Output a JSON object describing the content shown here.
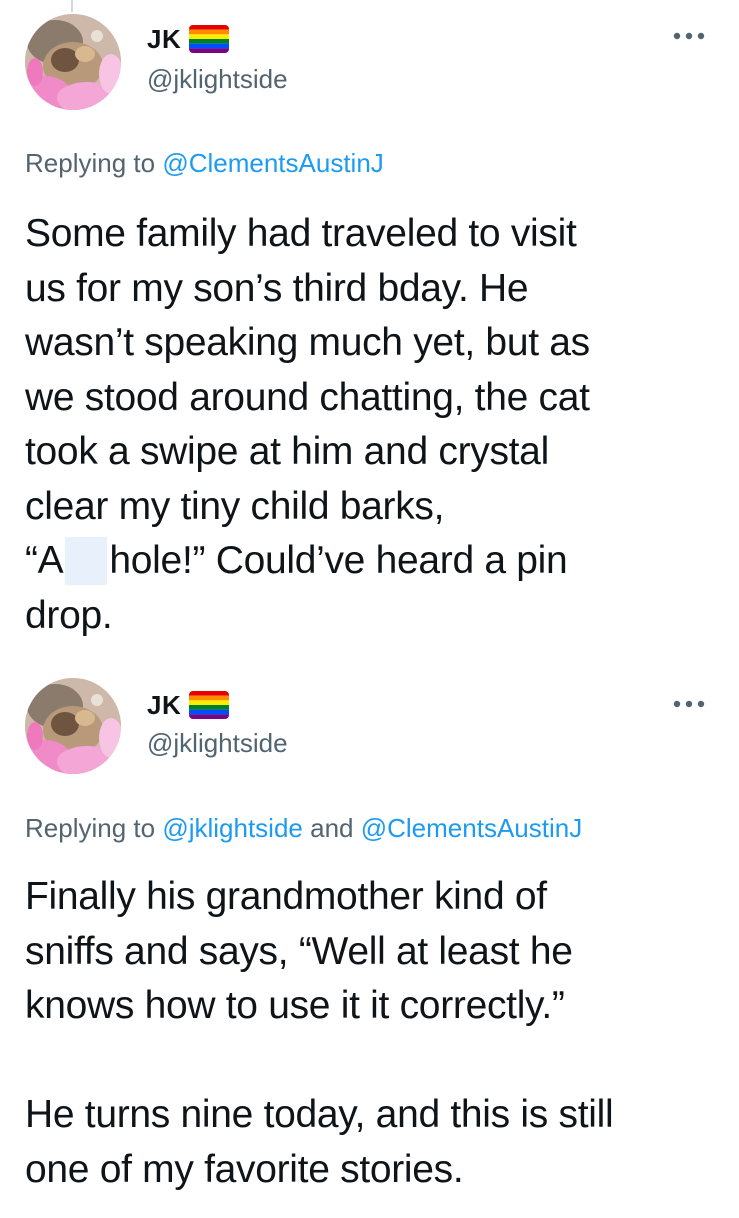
{
  "tweets": [
    {
      "display_name": "JK",
      "handle": "@jklightside",
      "reply_prefix": "Replying to",
      "reply_mentions": [
        "@ClementsAustinJ"
      ],
      "reply_joiner": "",
      "more_icon": "more-dots-icon",
      "flag_icon": "rainbow-flag-icon",
      "text_lines": [
        "Some family had traveled to visit",
        "us for my son’s third bday. He",
        "wasn’t speaking much yet, but as",
        "we stood around chatting, the cat",
        "took a swipe at him and crystal",
        "clear my tiny child barks,"
      ],
      "redacted_line": {
        "before": "“A",
        "after": "hole!” Could’ve heard a pin"
      },
      "text_last_line": "drop."
    },
    {
      "display_name": "JK",
      "handle": "@jklightside",
      "reply_prefix": "Replying to",
      "reply_mentions": [
        "@jklightside",
        "@ClementsAustinJ"
      ],
      "reply_joiner": "and",
      "more_icon": "more-dots-icon",
      "flag_icon": "rainbow-flag-icon",
      "paragraph_1": [
        "Finally his grandmother kind of",
        "sniffs and says, “Well at least he",
        "knows how to use it it correctly.”"
      ],
      "paragraph_2": [
        "He turns nine today, and this is still",
        "one of my favorite stories."
      ]
    }
  ],
  "colors": {
    "text_primary": "#0f1419",
    "text_secondary": "#536471",
    "link": "#1d9bf0",
    "redaction": "#e8f1fb",
    "flag_stripes": [
      "#e40303",
      "#ff8c00",
      "#ffed00",
      "#008026",
      "#004dff",
      "#750787"
    ]
  }
}
